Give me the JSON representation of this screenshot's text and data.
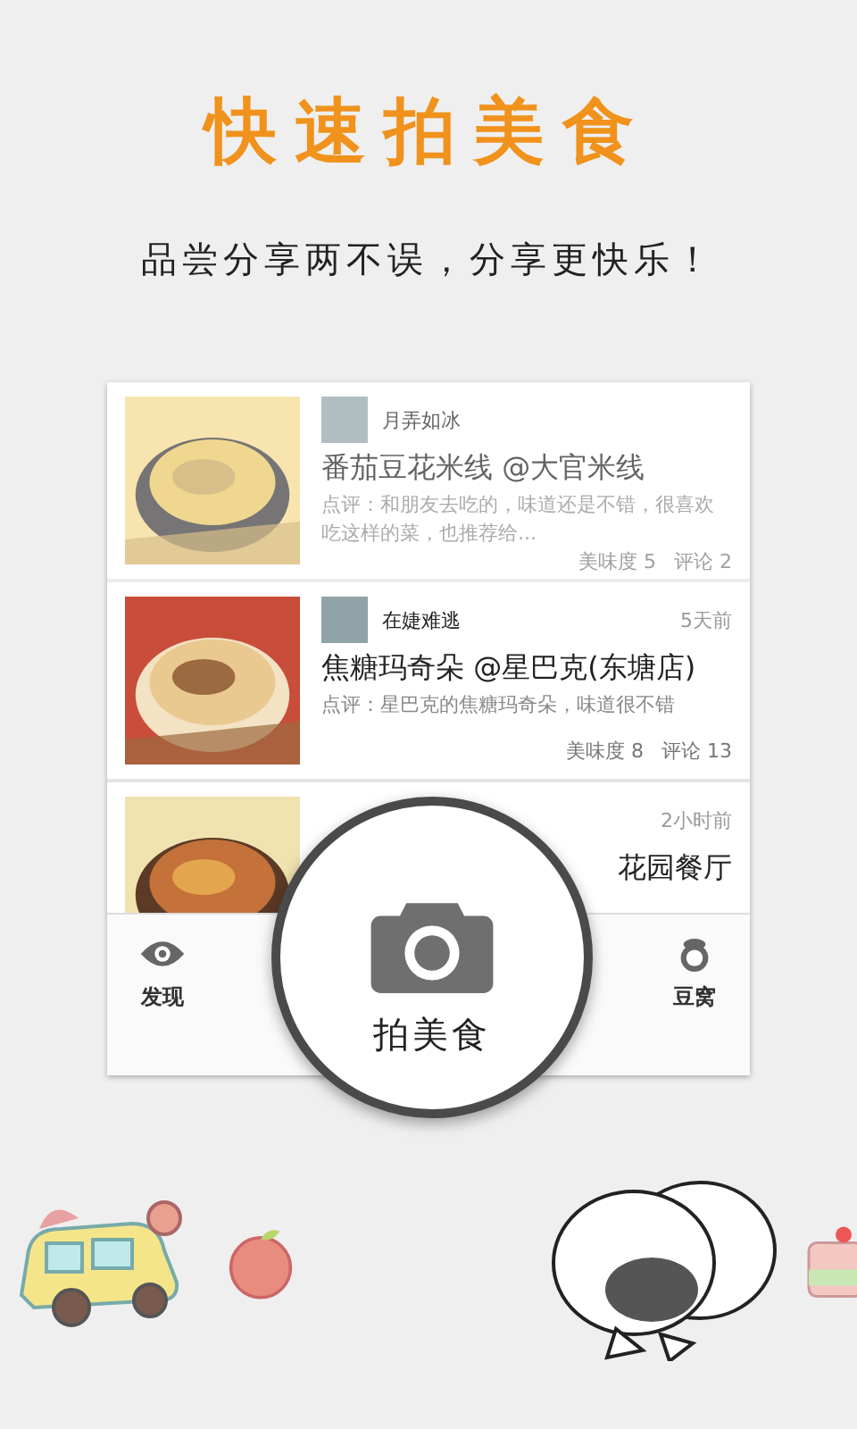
{
  "header": {
    "title": "快速拍美食",
    "subtitle": "品尝分享两不误，分享更快乐！"
  },
  "feed": [
    {
      "faded": true,
      "user": "月弄如冰",
      "title": "番茄豆花米线 @大官米线",
      "review": "点评：和朋友去吃的，味道还是不错，很喜欢吃这样的菜，也推荐给...",
      "taste": "美味度 5",
      "comments": "评论 2"
    },
    {
      "faded": false,
      "user": "在婕难逃",
      "time": "5天前",
      "title": "焦糖玛奇朵 @星巴克(东塘店)",
      "review": "点评：星巴克的焦糖玛奇朵，味道很不错",
      "taste": "美味度 8",
      "comments": "评论 13"
    },
    {
      "faded": false,
      "time": "2小时前",
      "title": "花园餐厅"
    }
  ],
  "tabs": [
    {
      "label": "发现",
      "kind": "eye"
    },
    {
      "label": "豆窝",
      "kind": "pot"
    }
  ],
  "magnifier": {
    "label": "拍美食"
  }
}
